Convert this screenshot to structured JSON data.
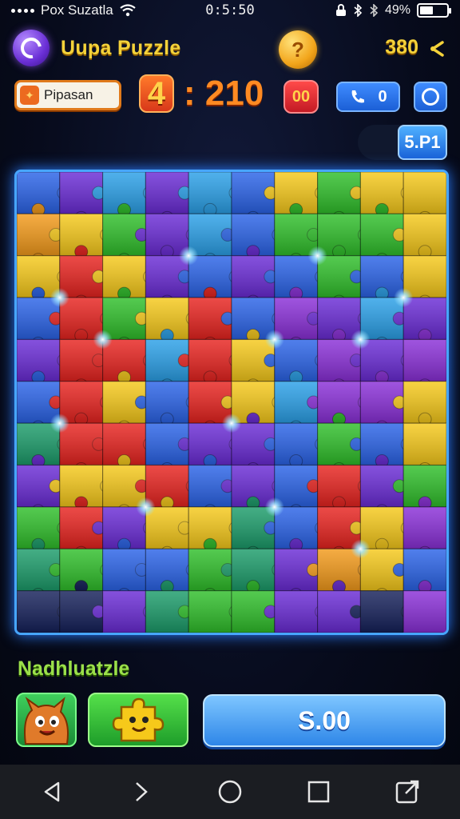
{
  "status_bar": {
    "carrier": "Pox Suzatla",
    "time": "0:5:50",
    "battery_text": "49%",
    "battery_level": 0.49
  },
  "header": {
    "title": "Uupa Puzzle",
    "score": "380",
    "coin_glyph": "?"
  },
  "controls": {
    "mode_label": "Pipasan",
    "timer_badge": "4",
    "timer_text": ": 210",
    "red_badge": "00",
    "call_count": "0"
  },
  "progress": {
    "value": "5.P1"
  },
  "board": {
    "rows": 11,
    "cols": 10,
    "palette": {
      "R": "#e8231f",
      "O": "#f39a1a",
      "Y": "#f6c91a",
      "G": "#2fbf2a",
      "T": "#1b9c6a",
      "B": "#2a63e8",
      "L": "#2aa0e8",
      "P": "#6a2bd6",
      "V": "#8a2fd8",
      "K": "#15205a"
    },
    "grid": [
      "BPLPLBYGYY",
      "OYGPLBGGGY",
      "YRYPBPBGBY",
      "BRGYRBVPLP",
      "PRRLRYBVPV",
      "BRYBRYLVVY",
      "TRRBPPBGBY",
      "PYYRBPBRPG",
      "GRPYYTBRYV",
      "TGBBGTPOYB",
      "KKPTGGPPKV"
    ],
    "glows": [
      [
        1,
        3
      ],
      [
        4,
        2
      ],
      [
        7,
        2
      ],
      [
        9,
        3
      ],
      [
        2,
        4
      ],
      [
        6,
        4
      ],
      [
        8,
        4
      ],
      [
        1,
        6
      ],
      [
        5,
        6
      ],
      [
        3,
        8
      ],
      [
        6,
        8
      ],
      [
        8,
        9
      ]
    ]
  },
  "bottom": {
    "section_label": "Nadhluatzle",
    "price_label": "S.00"
  },
  "colors": {
    "accent_gold": "#f4d23a",
    "timer_orange": "#ff8a22",
    "button_blue": "#2e86e8",
    "label_green": "#9be04a",
    "board_border": "#47a6ff"
  },
  "icons": {
    "nav": [
      "back-icon",
      "forward-icon",
      "home-icon",
      "recents-icon",
      "edit-icon"
    ]
  }
}
